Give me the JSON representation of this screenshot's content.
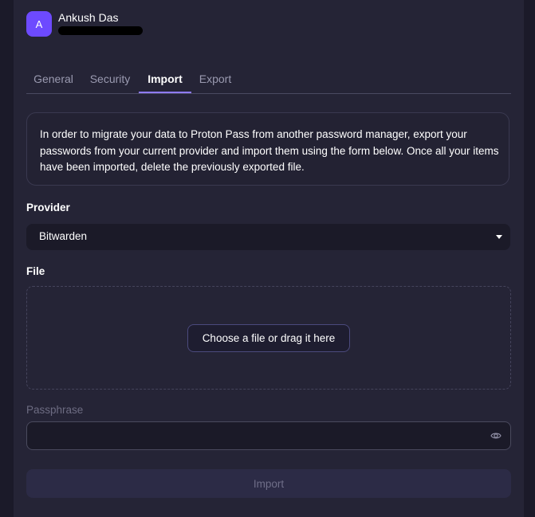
{
  "profile": {
    "avatar_letter": "A",
    "name": "Ankush Das"
  },
  "tabs": [
    {
      "label": "General",
      "active": false
    },
    {
      "label": "Security",
      "active": false
    },
    {
      "label": "Import",
      "active": true
    },
    {
      "label": "Export",
      "active": false
    }
  ],
  "info": {
    "text": "In order to migrate your data to Proton Pass from another password manager, export your passwords from your current provider and import them using the form below. Once all your items have been imported, delete the previously exported file."
  },
  "provider": {
    "label": "Provider",
    "selected": "Bitwarden"
  },
  "file": {
    "label": "File",
    "button_label": "Choose a file or drag it here"
  },
  "passphrase": {
    "label": "Passphrase",
    "value": ""
  },
  "import_button": {
    "label": "Import",
    "disabled": true
  },
  "colors": {
    "accent": "#6d4aff",
    "tab_underline": "#8f7bff",
    "background": "#1b1a29",
    "panel": "#252436"
  },
  "icons": {
    "select_caret": "caret-down-icon",
    "passphrase_toggle": "eye-icon"
  }
}
